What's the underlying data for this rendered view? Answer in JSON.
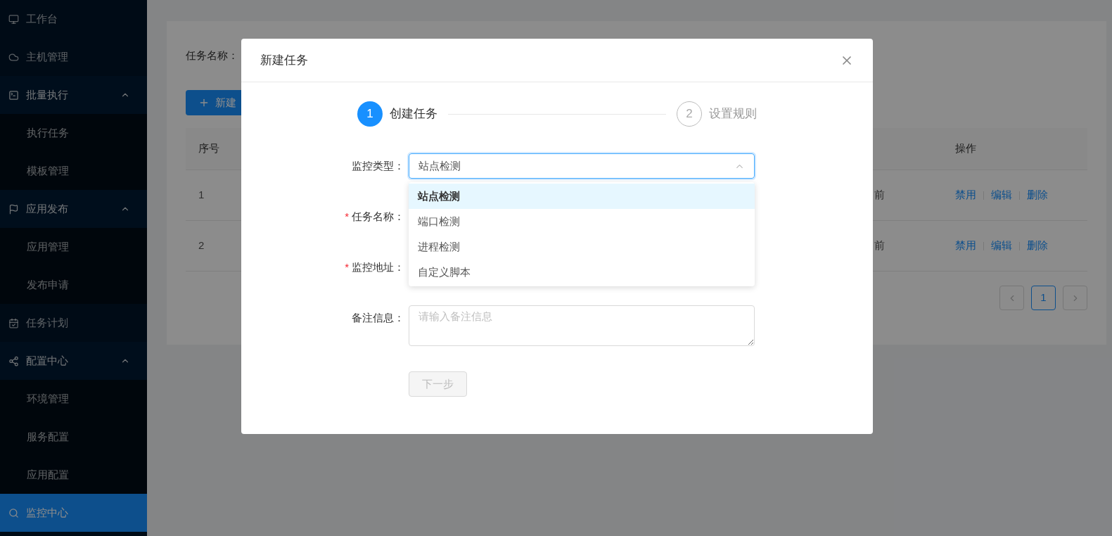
{
  "sidebar": {
    "items": [
      {
        "label": "工作台",
        "selected": false
      },
      {
        "label": "主机管理",
        "selected": false
      },
      {
        "label": "批量执行",
        "selected": false,
        "expanded": true,
        "children": [
          {
            "label": "执行任务",
            "selected": false
          },
          {
            "label": "模板管理",
            "selected": false
          }
        ]
      },
      {
        "label": "应用发布",
        "selected": false,
        "expanded": true,
        "children": [
          {
            "label": "应用管理",
            "selected": false
          },
          {
            "label": "发布申请",
            "selected": false
          }
        ]
      },
      {
        "label": "任务计划",
        "selected": false
      },
      {
        "label": "配置中心",
        "selected": false,
        "expanded": true,
        "children": [
          {
            "label": "环境管理",
            "selected": false
          },
          {
            "label": "服务配置",
            "selected": false
          },
          {
            "label": "应用配置",
            "selected": false
          }
        ]
      },
      {
        "label": "监控中心",
        "selected": true
      }
    ]
  },
  "query": {
    "label": "任务名称："
  },
  "new_button": {
    "label": "新建"
  },
  "table": {
    "columns": [
      "序号",
      "操作"
    ],
    "rows": [
      {
        "cells": [
          "1",
          "前"
        ],
        "actions": [
          "禁用",
          "编辑",
          "删除"
        ]
      },
      {
        "cells": [
          "2",
          "前"
        ],
        "actions": [
          "禁用",
          "编辑",
          "删除"
        ]
      }
    ]
  },
  "pagination": {
    "pages": [
      {
        "label": "1",
        "selected": true
      }
    ]
  },
  "modal": {
    "title": "新建任务",
    "steps": [
      {
        "number": "1",
        "label": "创建任务",
        "selected": true
      },
      {
        "number": "2",
        "label": "设置规则",
        "selected": false
      }
    ],
    "fields": [
      {
        "kind": "select",
        "label": "监控类型：",
        "value": "站点检测",
        "expanded": true
      },
      {
        "kind": "input",
        "label": "任务名称：",
        "required_mark": "*"
      },
      {
        "kind": "input",
        "label": "监控地址：",
        "required_mark": "*"
      },
      {
        "kind": "textarea",
        "label": "备注信息：",
        "placeholder": "请输入备注信息"
      }
    ],
    "options": [
      {
        "label": "站点检测",
        "selected": true
      },
      {
        "label": "端口检测",
        "selected": false
      },
      {
        "label": "进程检测",
        "selected": false
      },
      {
        "label": "自定义脚本",
        "selected": false
      }
    ],
    "next_button": {
      "label": "下一步",
      "disabled": true
    }
  }
}
